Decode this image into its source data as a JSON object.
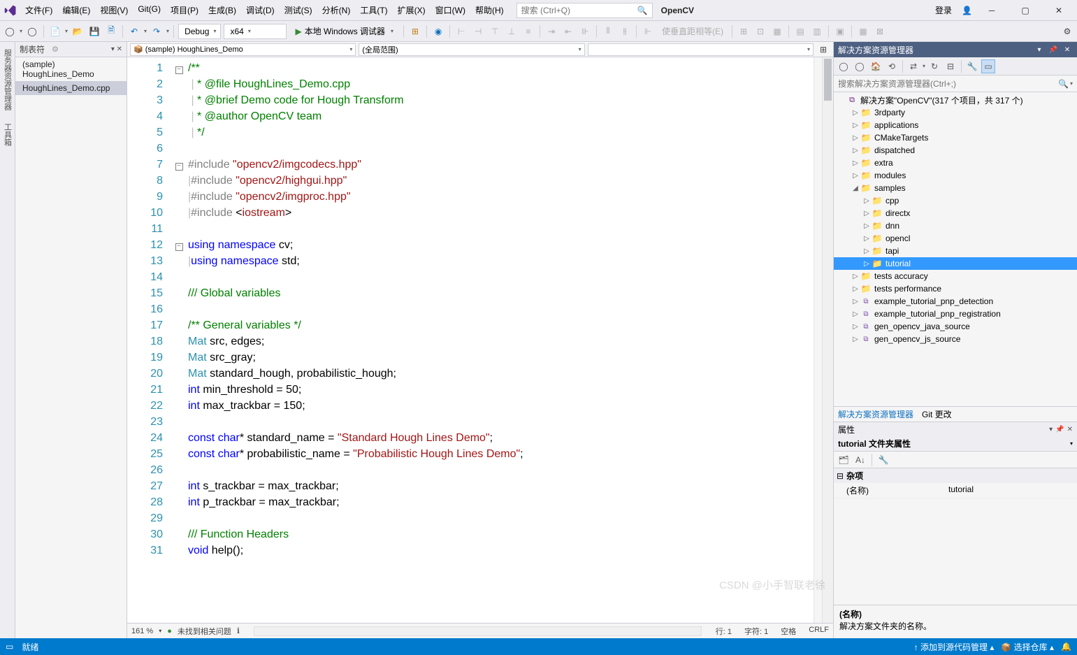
{
  "menu": {
    "items": [
      "文件(F)",
      "编辑(E)",
      "视图(V)",
      "Git(G)",
      "项目(P)",
      "生成(B)",
      "调试(D)",
      "测试(S)",
      "分析(N)",
      "工具(T)",
      "扩展(X)",
      "窗口(W)",
      "帮助(H)"
    ]
  },
  "search": {
    "placeholder": "搜索 (Ctrl+Q)"
  },
  "title": "OpenCV",
  "login": "登录",
  "toolbar": {
    "config": "Debug",
    "platform": "x64",
    "run": "本地 Windows 调试器",
    "tool_long": "使垂直距相等(E)"
  },
  "sidebar": {
    "header": "制表符",
    "items": [
      "(sample) HoughLines_Demo",
      "HoughLines_Demo.cpp"
    ]
  },
  "vtabs": [
    "服务器资源管理器",
    "工具箱"
  ],
  "nav": {
    "a": "(sample) HoughLines_Demo",
    "b": "(全局范围)",
    "c": ""
  },
  "code_lines": [
    {
      "n": 1,
      "f": "-",
      "seg": [
        [
          "c-comment",
          "/**"
        ]
      ]
    },
    {
      "n": 2,
      "seg": [
        [
          "c-bar",
          " |"
        ],
        [
          "c-comment",
          " * @file HoughLines_Demo.cpp"
        ]
      ]
    },
    {
      "n": 3,
      "seg": [
        [
          "c-bar",
          " |"
        ],
        [
          "c-comment",
          " * @brief Demo code for Hough Transform"
        ]
      ]
    },
    {
      "n": 4,
      "seg": [
        [
          "c-bar",
          " |"
        ],
        [
          "c-comment",
          " * @author OpenCV team"
        ]
      ]
    },
    {
      "n": 5,
      "seg": [
        [
          "c-bar",
          " |"
        ],
        [
          "c-comment",
          " */"
        ]
      ]
    },
    {
      "n": 6,
      "seg": []
    },
    {
      "n": 7,
      "f": "-",
      "seg": [
        [
          "c-pre",
          "#include "
        ],
        [
          "c-str",
          "\"opencv2/imgcodecs.hpp\""
        ]
      ]
    },
    {
      "n": 8,
      "seg": [
        [
          "c-bar",
          "|"
        ],
        [
          "c-pre",
          "#include "
        ],
        [
          "c-str",
          "\"opencv2/highgui.hpp\""
        ]
      ]
    },
    {
      "n": 9,
      "seg": [
        [
          "c-bar",
          "|"
        ],
        [
          "c-pre",
          "#include "
        ],
        [
          "c-str",
          "\"opencv2/imgproc.hpp\""
        ]
      ]
    },
    {
      "n": 10,
      "seg": [
        [
          "c-bar",
          "|"
        ],
        [
          "c-pre",
          "#include "
        ],
        [
          "",
          "<"
        ],
        [
          "c-str",
          "iostream"
        ],
        [
          "",
          ">"
        ]
      ]
    },
    {
      "n": 11,
      "seg": []
    },
    {
      "n": 12,
      "f": "-",
      "seg": [
        [
          "c-kw",
          "using"
        ],
        [
          "",
          " "
        ],
        [
          "c-kw",
          "namespace"
        ],
        [
          "",
          " cv;"
        ]
      ]
    },
    {
      "n": 13,
      "seg": [
        [
          "c-bar",
          "|"
        ],
        [
          "c-kw",
          "using"
        ],
        [
          "",
          " "
        ],
        [
          "c-kw",
          "namespace"
        ],
        [
          "",
          " std;"
        ]
      ]
    },
    {
      "n": 14,
      "seg": []
    },
    {
      "n": 15,
      "seg": [
        [
          "c-comment",
          "/// Global variables"
        ]
      ]
    },
    {
      "n": 16,
      "seg": []
    },
    {
      "n": 17,
      "seg": [
        [
          "c-comment",
          "/** General variables */"
        ]
      ]
    },
    {
      "n": 18,
      "seg": [
        [
          "c-type",
          "Mat"
        ],
        [
          "",
          " src, edges;"
        ]
      ]
    },
    {
      "n": 19,
      "seg": [
        [
          "c-type",
          "Mat"
        ],
        [
          "",
          " src_gray;"
        ]
      ]
    },
    {
      "n": 20,
      "seg": [
        [
          "c-type",
          "Mat"
        ],
        [
          "",
          " standard_hough, probabilistic_hough;"
        ]
      ]
    },
    {
      "n": 21,
      "seg": [
        [
          "c-kw",
          "int"
        ],
        [
          "",
          " min_threshold = 50;"
        ]
      ]
    },
    {
      "n": 22,
      "seg": [
        [
          "c-kw",
          "int"
        ],
        [
          "",
          " max_trackbar = 150;"
        ]
      ]
    },
    {
      "n": 23,
      "seg": []
    },
    {
      "n": 24,
      "seg": [
        [
          "c-kw",
          "const"
        ],
        [
          "",
          " "
        ],
        [
          "c-kw",
          "char"
        ],
        [
          "",
          "* standard_name = "
        ],
        [
          "c-str",
          "\"Standard Hough Lines Demo\""
        ],
        [
          "",
          ";"
        ]
      ]
    },
    {
      "n": 25,
      "seg": [
        [
          "c-kw",
          "const"
        ],
        [
          "",
          " "
        ],
        [
          "c-kw",
          "char"
        ],
        [
          "",
          "* probabilistic_name = "
        ],
        [
          "c-str",
          "\"Probabilistic Hough Lines Demo\""
        ],
        [
          "",
          ";"
        ]
      ]
    },
    {
      "n": 26,
      "seg": []
    },
    {
      "n": 27,
      "seg": [
        [
          "c-kw",
          "int"
        ],
        [
          "",
          " s_trackbar = max_trackbar;"
        ]
      ]
    },
    {
      "n": 28,
      "seg": [
        [
          "c-kw",
          "int"
        ],
        [
          "",
          " p_trackbar = max_trackbar;"
        ]
      ]
    },
    {
      "n": 29,
      "seg": []
    },
    {
      "n": 30,
      "seg": [
        [
          "c-comment",
          "/// Function Headers"
        ]
      ]
    },
    {
      "n": 31,
      "seg": [
        [
          "c-kw",
          "void"
        ],
        [
          "",
          " help();"
        ]
      ]
    }
  ],
  "editor_foot": {
    "zoom": "161 %",
    "msg": "未找到相关问题",
    "line": "行: 1",
    "col": "字符: 1",
    "space": "空格",
    "crlf": "CRLF"
  },
  "sx": {
    "title": "解决方案资源管理器",
    "search": "搜索解决方案资源管理器(Ctrl+;)",
    "root": "解决方案\"OpenCV\"(317 个项目，共 317 个)",
    "nodes": [
      {
        "d": 1,
        "e": "▷",
        "i": "folder",
        "l": "3rdparty"
      },
      {
        "d": 1,
        "e": "▷",
        "i": "folder",
        "l": "applications"
      },
      {
        "d": 1,
        "e": "▷",
        "i": "folder",
        "l": "CMakeTargets"
      },
      {
        "d": 1,
        "e": "▷",
        "i": "folder",
        "l": "dispatched"
      },
      {
        "d": 1,
        "e": "▷",
        "i": "folder",
        "l": "extra"
      },
      {
        "d": 1,
        "e": "▷",
        "i": "folder",
        "l": "modules"
      },
      {
        "d": 1,
        "e": "◢",
        "i": "folder",
        "l": "samples"
      },
      {
        "d": 2,
        "e": "▷",
        "i": "folder",
        "l": "cpp"
      },
      {
        "d": 2,
        "e": "▷",
        "i": "folder",
        "l": "directx"
      },
      {
        "d": 2,
        "e": "▷",
        "i": "folder",
        "l": "dnn"
      },
      {
        "d": 2,
        "e": "▷",
        "i": "folder",
        "l": "opencl"
      },
      {
        "d": 2,
        "e": "▷",
        "i": "folder",
        "l": "tapi"
      },
      {
        "d": 2,
        "e": "▷",
        "i": "folder",
        "l": "tutorial",
        "sel": true
      },
      {
        "d": 1,
        "e": "▷",
        "i": "folder",
        "l": "tests accuracy"
      },
      {
        "d": 1,
        "e": "▷",
        "i": "folder",
        "l": "tests performance"
      },
      {
        "d": 1,
        "e": "▷",
        "i": "cpp",
        "l": "example_tutorial_pnp_detection"
      },
      {
        "d": 1,
        "e": "▷",
        "i": "cpp",
        "l": "example_tutorial_pnp_registration"
      },
      {
        "d": 1,
        "e": "▷",
        "i": "cpp",
        "l": "gen_opencv_java_source"
      },
      {
        "d": 1,
        "e": "▷",
        "i": "cpp",
        "l": "gen_opencv_js_source"
      }
    ],
    "tabs": [
      "解决方案资源管理器",
      "Git 更改"
    ]
  },
  "props": {
    "title": "属性",
    "sub": "tutorial 文件夹属性",
    "cat": "杂项",
    "name_k": "(名称)",
    "name_v": "tutorial",
    "desc_k": "(名称)",
    "desc_v": "解决方案文件夹的名称。"
  },
  "status": {
    "ready": "就绪",
    "add": "添加到源代码管理",
    "sel": "选择仓库"
  },
  "watermark": "CSDN @小手智联老徐"
}
